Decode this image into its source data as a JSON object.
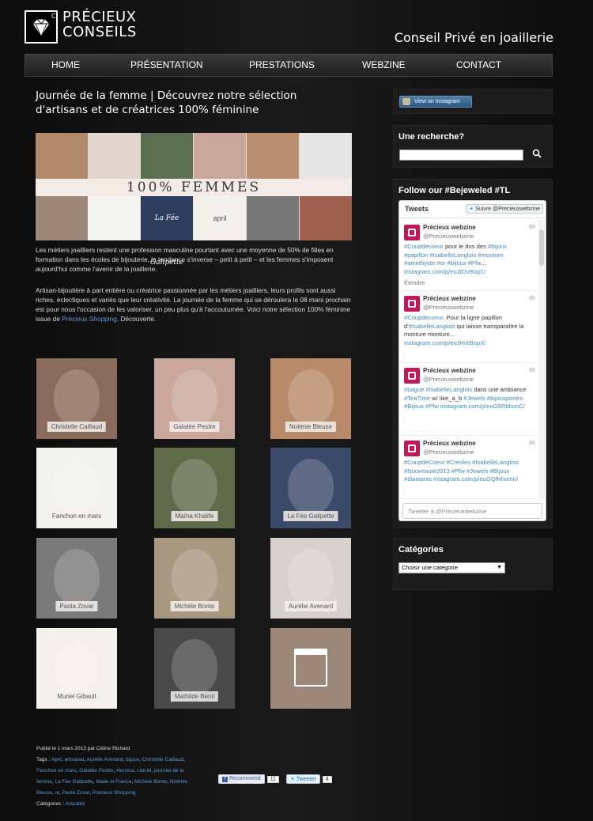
{
  "header": {
    "logo_line1": "PRÉCIEUX",
    "logo_line2": "CONSEILS",
    "logo_mark": "C",
    "tagline": "Conseil Privé en joaillerie"
  },
  "nav": {
    "items": [
      "HOME",
      "PRÉSENTATION",
      "PRESTATIONS",
      "WEBZINE",
      "CONTACT"
    ]
  },
  "article": {
    "title_line1": "Journée de la femme | Découvrez notre sélection",
    "title_line2": "d'artisans et de créatrices 100% féminine",
    "hero_banner": "100% FEMMES",
    "hero_tiles": [
      "La Fée Galipette",
      "april"
    ],
    "para1": "Les métiers joailliers restent une profession masculine pourtant avec une moyenne de 50% de filles en formation dans les écoles de bijouterie, la tendance s'inverse – petit à petit – et les femmes s'imposent aujourd'hui comme l'avenir de la joaillerie.",
    "para2_before": "Artisan-bijoutière à part entière ou créatrice passionnée par les métiers joailliers, leurs profils sont aussi riches, éclectiques et variés que leur créativité. La journée de la femme qui se déroulera le 08 mars prochain est pour nous l'occasion de les valoriser, un peu plus qu'à l'accoutumée. Voici notre sélection 100% féminine issue de ",
    "para2_link": "Précieux Shopping",
    "para2_after": ". Découverte.",
    "grid": [
      {
        "label": "Christelle Caillaud",
        "bg": "#8a6a5a"
      },
      {
        "label": "Galatée Pestre",
        "bg": "#c9a79a"
      },
      {
        "label": "Noëmie Bleuse",
        "bg": "#b88a6a"
      },
      {
        "label": "Fanchon en mars",
        "bg": "#f2f2ee"
      },
      {
        "label": "Maïna Khalife",
        "bg": "#5e6a48"
      },
      {
        "label": "La Fée Galipette",
        "bg": "#3c4a6a"
      },
      {
        "label": "Paola Zovar",
        "bg": "#7a7a7a"
      },
      {
        "label": "Michèle Bonte",
        "bg": "#a99880"
      },
      {
        "label": "Aurélie Avenard",
        "bg": "#d8d0cc"
      },
      {
        "label": "Muriel Gibault",
        "bg": "#f4f0ea"
      },
      {
        "label": "Mathilde Bénil",
        "bg": "#4a4a4a"
      },
      {
        "label": "",
        "bg": "#9d8778"
      }
    ]
  },
  "footer": {
    "published": "Publié le 1 mars 2013 par Céline Richard",
    "tags_label": "Tags : ",
    "tags": [
      "April",
      "artisanat",
      "Aurélie Avenard",
      "bijoux",
      "Christelle Caillaud",
      "Fanchon en mars",
      "Galatée Pestre",
      "Hornica",
      "I.de.M",
      "journée de la femme",
      "La Fée Galipette",
      "Made in France",
      "Michele Bonte",
      "Noëmie Bleuse",
      "or",
      "Paola Zovar",
      "Précieux Shopping"
    ],
    "categories_label": "Catégories : ",
    "category": "Actualité",
    "fb_label": "Recommend",
    "fb_count": "11",
    "tw_label": "Tweeter",
    "tw_count": "4"
  },
  "sidebar": {
    "instagram_button": "View on Instagram",
    "search_title": "Une recherche?",
    "search_placeholder": "",
    "twitter_title": "Follow our #Bejeweled #TL",
    "tw_header": "Tweets",
    "tw_follow": "Suivre @Precieuxwebzine",
    "tweets": [
      {
        "name": "Précieux webzine",
        "handle": "@Precieuxwebzine",
        "time": "6h",
        "parts": [
          [
            "#Coupdecoeur",
            true
          ],
          [
            " pour le dos des ",
            false
          ],
          [
            "#bijoux",
            true
          ],
          [
            " ",
            false
          ],
          [
            "#papillon",
            true
          ],
          [
            " ",
            false
          ],
          [
            "#IsabelleLanglois",
            true
          ],
          [
            " ",
            false
          ],
          [
            "#monture",
            true
          ],
          [
            " ",
            false
          ],
          [
            "#amethyste",
            true
          ],
          [
            " ",
            false
          ],
          [
            "#or",
            true
          ],
          [
            " ",
            false
          ],
          [
            "#bijoux",
            true
          ],
          [
            " ",
            false
          ],
          [
            "#Pfw",
            true
          ],
          [
            "... ",
            false
          ],
          [
            "instagram.com/p/euJtDVBop1/",
            true
          ]
        ],
        "extra": "Étendre"
      },
      {
        "name": "Précieux webzine",
        "handle": "@Precieuxwebzine",
        "time": "6h",
        "parts": [
          [
            "#Coupdecoeur",
            true
          ],
          [
            ". Pour la ligne papillon d'",
            false
          ],
          [
            "#IsabelleLanglois",
            true
          ],
          [
            " qui laisse transparaître la monture monture... ",
            false
          ],
          [
            "instagram.com/p/euJHiXBopX/",
            true
          ]
        ],
        "extra": ""
      },
      {
        "name": "Précieux webzine",
        "handle": "@Precieuxwebzine",
        "time": "6h",
        "parts": [
          [
            "#bague",
            true
          ],
          [
            " ",
            false
          ],
          [
            "#IsabelleLanglois",
            true
          ],
          [
            " dans une ambiance ",
            false
          ],
          [
            "#TeaTime",
            true
          ],
          [
            " w/ like_a_b ",
            false
          ],
          [
            "#Jewels",
            true
          ],
          [
            " ",
            false
          ],
          [
            "#bijouxportés",
            true
          ],
          [
            " ",
            false
          ],
          [
            "#Bijoux",
            true
          ],
          [
            " ",
            false
          ],
          [
            "#Pfw",
            true
          ],
          [
            " ",
            false
          ],
          [
            "instagram.com/p/euG5RbhonC/",
            true
          ]
        ],
        "extra": ""
      },
      {
        "name": "Précieux webzine",
        "handle": "@Precieuxwebzine",
        "time": "6h",
        "parts": [
          [
            "#CoupdeCoeur",
            true
          ],
          [
            " ",
            false
          ],
          [
            "#Créoles",
            true
          ],
          [
            " ",
            false
          ],
          [
            "#IsabelleLanglois",
            true
          ],
          [
            " ",
            false
          ],
          [
            "#Nouveaute2013",
            true
          ],
          [
            " ",
            false
          ],
          [
            "#Pfw",
            true
          ],
          [
            " ",
            false
          ],
          [
            "#Jewels",
            true
          ],
          [
            " ",
            false
          ],
          [
            "#Bijoux",
            true
          ],
          [
            " ",
            false
          ],
          [
            "#diamants",
            true
          ],
          [
            " ",
            false
          ],
          [
            "instagram.com/p/euGQlNhomn/",
            true
          ]
        ],
        "extra": ""
      }
    ],
    "tw_compose": "Tweeter à @Precieuxwebzine",
    "categories_title": "Catégories",
    "categories_select": "Choisir une catégorie"
  },
  "colors": {
    "link": "#5b9bd5",
    "twitter_link": "#3d8abf",
    "avatar": "#c2185b"
  }
}
